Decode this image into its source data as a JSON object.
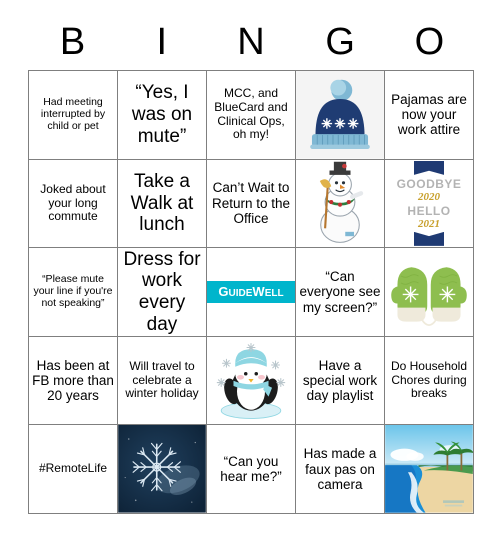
{
  "header": {
    "letters": [
      "B",
      "I",
      "N",
      "G",
      "O"
    ]
  },
  "colors": {
    "grid_line": "#7f7f7f",
    "text": "#000000",
    "guidewell_teal": "#00b5cc",
    "hat_navy": "#1f3c73",
    "hat_light_blue": "#7fb8d4",
    "mitten_green": "#8ebe4f",
    "mitten_cream": "#efeadb",
    "banner_navy": "#1f3a73",
    "banner_silver": "#b3b3b3",
    "banner_gold": "#c8a02c",
    "penguin_blue": "#8ed6e2",
    "snowflake_bg": "#0e2338",
    "beach_sky": "#8fd4ef",
    "beach_sand": "#edd6a3",
    "beach_water": "#1b8fd6",
    "beach_palm": "#2e7d32"
  },
  "grid": {
    "rows": [
      [
        {
          "type": "text",
          "name": "cell-b1",
          "text": "Had meeting interrupted by child or pet",
          "size": "xs"
        },
        {
          "type": "text",
          "name": "cell-i1",
          "text": "“Yes, I was on mute”",
          "size": "l"
        },
        {
          "type": "text",
          "name": "cell-n1",
          "text": "MCC, and BlueCard and Clinical Ops, oh my!",
          "size": "s"
        },
        {
          "type": "image",
          "name": "cell-g1",
          "art": "winter-hat-image",
          "alt": "Navy winter beanie hat with snowflakes and light blue pom-pom"
        },
        {
          "type": "text",
          "name": "cell-o1",
          "text": "Pajamas are now your work attire",
          "size": "m"
        }
      ],
      [
        {
          "type": "text",
          "name": "cell-b2",
          "text": "Joked about your long commute",
          "size": "s"
        },
        {
          "type": "text",
          "name": "cell-i2",
          "text": "Take a Walk at lunch",
          "size": "l"
        },
        {
          "type": "text",
          "name": "cell-n2",
          "text": "Can’t Wait to Return to the Office",
          "size": "m"
        },
        {
          "type": "image",
          "name": "cell-g2",
          "art": "snowman-image",
          "alt": "Snowman with top hat, broom and holly wreath"
        },
        {
          "type": "image",
          "name": "cell-o2",
          "art": "goodbye-2020-hello-2021-image",
          "alt": "Goodbye 2020 Hello 2021 banner",
          "labels": [
            "GOODBYE",
            "2020",
            "HELLO",
            "2021"
          ]
        }
      ],
      [
        {
          "type": "text",
          "name": "cell-b3",
          "text": "“Please mute your line if you're not speaking”",
          "size": "xs"
        },
        {
          "type": "text",
          "name": "cell-i3",
          "text": "Dress for work every day",
          "size": "l"
        },
        {
          "type": "image",
          "name": "cell-n3",
          "art": "guidewell-logo-image",
          "alt": "GuideWell logo",
          "labels": [
            "G",
            "UIDE",
            "W",
            "ELL"
          ]
        },
        {
          "type": "text",
          "name": "cell-g3",
          "text": "“Can everyone see my screen?”",
          "size": "m"
        },
        {
          "type": "image",
          "name": "cell-o3",
          "art": "mittens-image",
          "alt": "Pair of green knit mittens with snowflakes"
        }
      ],
      [
        {
          "type": "text",
          "name": "cell-b4",
          "text": "Has been at FB more than 20 years",
          "size": "m"
        },
        {
          "type": "text",
          "name": "cell-i4",
          "text": "Will travel to celebrate a winter holiday",
          "size": "s"
        },
        {
          "type": "image",
          "name": "cell-n4",
          "art": "penguin-image",
          "alt": "Penguin wearing blue hat and scarf with snowflakes"
        },
        {
          "type": "text",
          "name": "cell-g4",
          "text": "Have a special work day playlist",
          "size": "m"
        },
        {
          "type": "text",
          "name": "cell-o4",
          "text": "Do Household Chores during breaks",
          "size": "s"
        }
      ],
      [
        {
          "type": "text",
          "name": "cell-b5",
          "text": "#RemoteLife",
          "size": "s"
        },
        {
          "type": "image",
          "name": "cell-i5",
          "art": "snowflake-photo-image",
          "alt": "Photograph of a snowflake crystal on dark blue background"
        },
        {
          "type": "text",
          "name": "cell-n5",
          "text": "“Can you hear me?”",
          "size": "m"
        },
        {
          "type": "text",
          "name": "cell-g5",
          "text": "Has made a faux pas on camera",
          "size": "m"
        },
        {
          "type": "image",
          "name": "cell-o5",
          "art": "beach-image",
          "alt": "Tropical beach with palm trees and blue ocean"
        }
      ]
    ]
  }
}
